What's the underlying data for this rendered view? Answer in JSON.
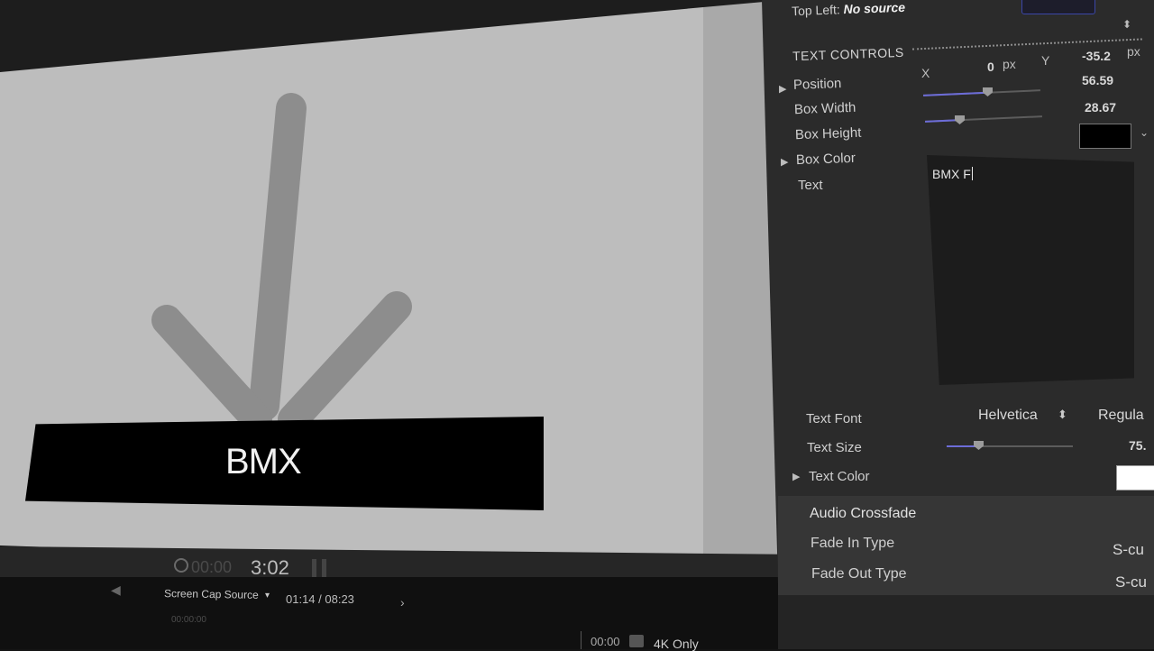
{
  "viewer": {
    "lower_third_text": "BMX",
    "timecode": "3:02",
    "timecode_ghost": "00:00",
    "source_label": "Screen Cap Source",
    "source_time": "01:14 / 08:23",
    "small_timecode": "00:00:00",
    "bottom_timecode": "00:00",
    "format_label": "4K Only"
  },
  "inspector": {
    "top_left_label": "Top Left:",
    "top_left_value": "No source",
    "text_controls_title": "TEXT CONTROLS",
    "position": {
      "label": "Position",
      "x_label": "X",
      "x_value": "0",
      "x_unit": "px",
      "y_label": "Y",
      "y_value": "-35.2",
      "y_unit": "px"
    },
    "box_width": {
      "label": "Box Width",
      "value": "56.59",
      "slider_fraction": 0.57
    },
    "box_height": {
      "label": "Box Height",
      "value": "28.67",
      "slider_fraction": 0.28
    },
    "box_color": {
      "label": "Box Color",
      "color": "#000000"
    },
    "text": {
      "label": "Text",
      "value": "BMX F"
    },
    "text_font": {
      "label": "Text Font",
      "family": "Helvetica",
      "style": "Regula"
    },
    "text_size": {
      "label": "Text Size",
      "value": "75.",
      "slider_fraction": 0.25
    },
    "text_color": {
      "label": "Text Color",
      "color": "#ffffff"
    },
    "audio_crossfade": {
      "title": "Audio Crossfade",
      "fade_in": {
        "label": "Fade In Type",
        "value": "S-cu"
      },
      "fade_out": {
        "label": "Fade Out Type",
        "value": "S-cu"
      }
    }
  }
}
